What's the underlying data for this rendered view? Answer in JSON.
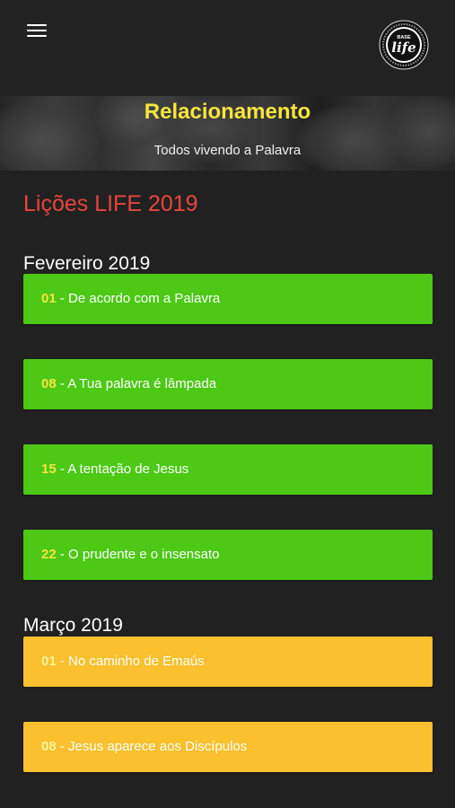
{
  "banner": {
    "title": "Relacionamento",
    "subtitle": "Todos vivendo a Palavra"
  },
  "logo": {
    "top_text": "BASE",
    "main_text": "life"
  },
  "page_title": "Lições LIFE 2019",
  "months": [
    {
      "label": "Fevereiro 2019",
      "color": "#4cc815",
      "lessons": [
        {
          "num": "01",
          "sep": " - ",
          "title": "De acordo com a Palavra"
        },
        {
          "num": "08",
          "sep": " - ",
          "title": "A Tua palavra é lâmpada"
        },
        {
          "num": "15",
          "sep": " - ",
          "title": "A tentação de Jesus"
        },
        {
          "num": "22",
          "sep": " - ",
          "title": "O prudente e o insensato"
        }
      ]
    },
    {
      "label": "Março 2019",
      "color": "#fbc02d",
      "lessons": [
        {
          "num": "01",
          "sep": " - ",
          "title": "No caminho de Emaús"
        },
        {
          "num": "08",
          "sep": " - ",
          "title": "Jesus aparece aos Discípulos"
        }
      ]
    }
  ],
  "icons": {
    "menu": "hamburger-menu-icon",
    "logo": "base-life-logo"
  }
}
